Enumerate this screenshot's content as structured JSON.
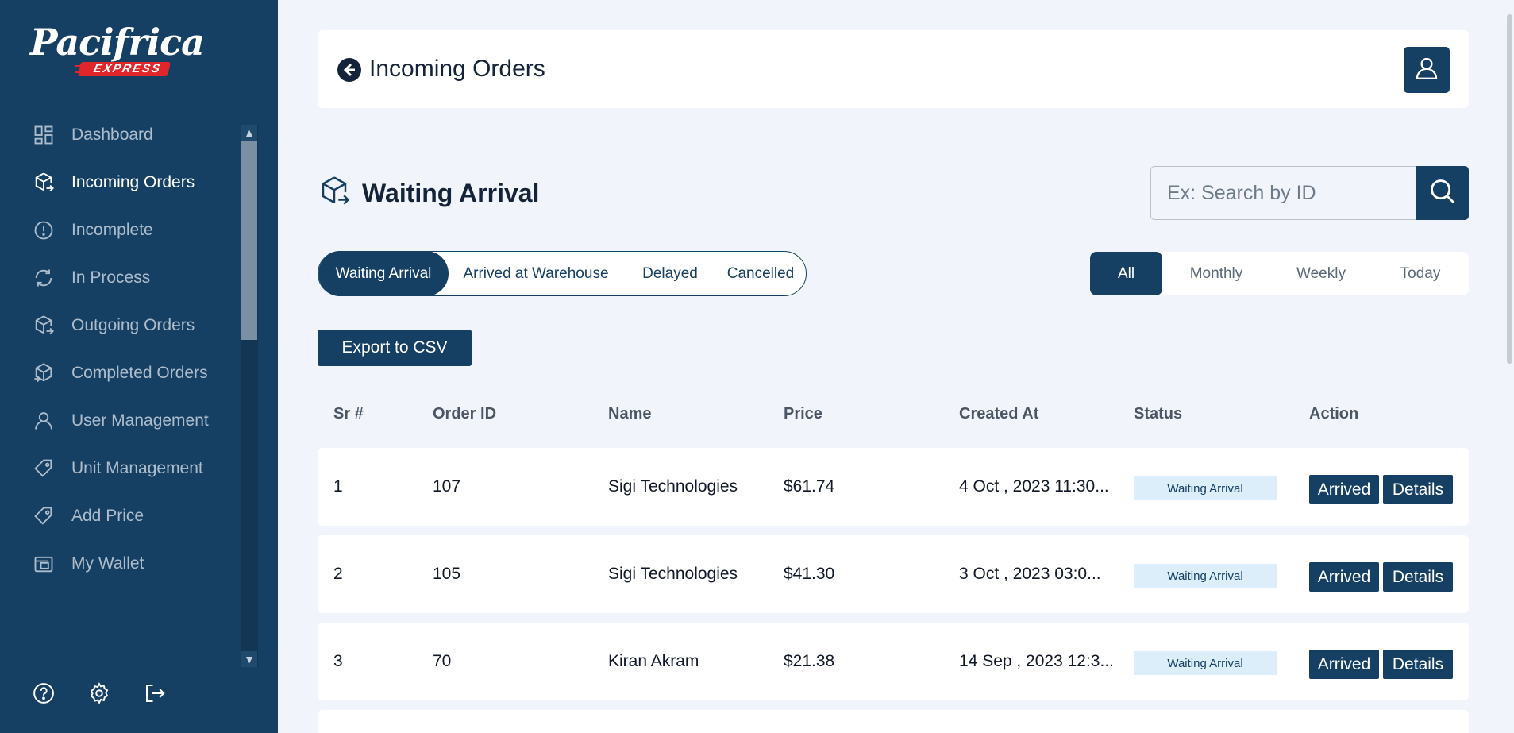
{
  "brand": {
    "name": "Pacifrica",
    "tagline": "EXPRESS",
    "primary_color": "#153f63",
    "accent_color": "#e0262b"
  },
  "sidebar": {
    "items": [
      {
        "label": "Dashboard",
        "icon": "dashboard-icon"
      },
      {
        "label": "Incoming Orders",
        "icon": "box-incoming-icon",
        "active": true
      },
      {
        "label": "Incomplete",
        "icon": "alert-circle-icon"
      },
      {
        "label": "In Process",
        "icon": "refresh-icon"
      },
      {
        "label": "Outgoing Orders",
        "icon": "box-outgoing-icon"
      },
      {
        "label": "Completed Orders",
        "icon": "box-completed-icon"
      },
      {
        "label": "User Management",
        "icon": "user-icon"
      },
      {
        "label": "Unit Management",
        "icon": "tag-icon"
      },
      {
        "label": "Add Price",
        "icon": "price-tag-icon"
      },
      {
        "label": "My Wallet",
        "icon": "wallet-icon"
      }
    ],
    "footer_icons": [
      "help-icon",
      "settings-icon",
      "logout-icon"
    ]
  },
  "header": {
    "title": "Incoming Orders"
  },
  "section": {
    "title": "Waiting Arrival"
  },
  "search": {
    "placeholder": "Ex: Search by ID",
    "value": ""
  },
  "status_tabs": [
    {
      "label": "Waiting Arrival",
      "active": true
    },
    {
      "label": "Arrived at Warehouse"
    },
    {
      "label": "Delayed"
    },
    {
      "label": "Cancelled"
    }
  ],
  "period_tabs": [
    {
      "label": "All",
      "active": true
    },
    {
      "label": "Monthly"
    },
    {
      "label": "Weekly"
    },
    {
      "label": "Today"
    }
  ],
  "export_label": "Export to CSV",
  "table": {
    "columns": [
      "Sr #",
      "Order ID",
      "Name",
      "Price",
      "Created At",
      "Status",
      "Action"
    ],
    "rows": [
      {
        "sr": "1",
        "order_id": "107",
        "name": "Sigi Technologies",
        "price": "$61.74",
        "created_at": "4 Oct , 2023 11:30...",
        "status": "Waiting Arrival",
        "arrived": "Arrived",
        "details": "Details"
      },
      {
        "sr": "2",
        "order_id": "105",
        "name": "Sigi Technologies",
        "price": "$41.30",
        "created_at": "3 Oct , 2023 03:0...",
        "status": "Waiting Arrival",
        "arrived": "Arrived",
        "details": "Details"
      },
      {
        "sr": "3",
        "order_id": "70",
        "name": "Kiran Akram",
        "price": "$21.38",
        "created_at": "14 Sep , 2023 12:3...",
        "status": "Waiting Arrival",
        "arrived": "Arrived",
        "details": "Details"
      }
    ]
  }
}
